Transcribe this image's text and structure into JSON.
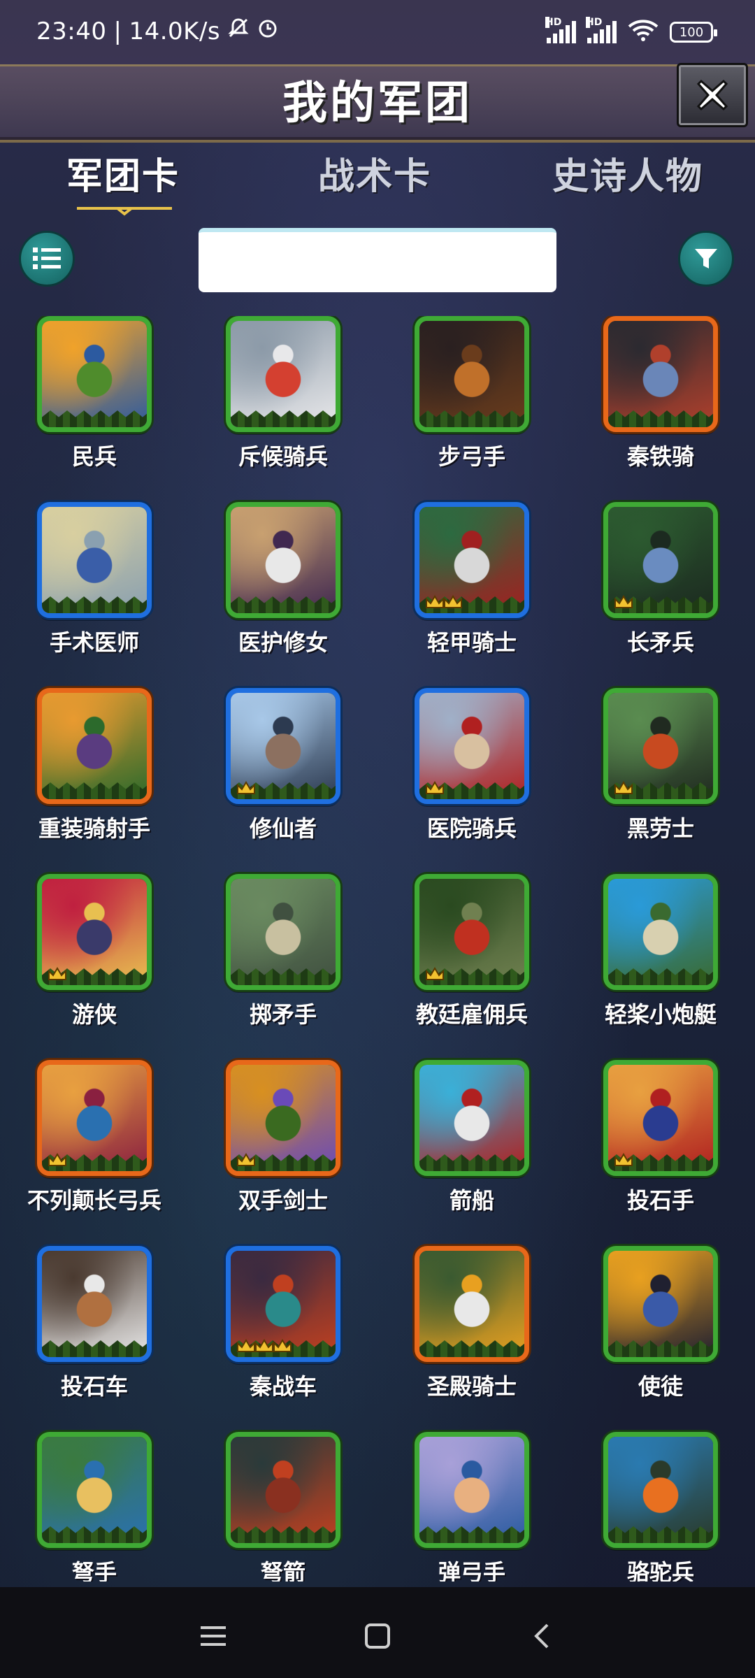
{
  "status_bar": {
    "time": "23:40",
    "network_speed": "14.0K/s",
    "battery": "100",
    "icons": [
      "bell-muted-icon",
      "alarm-icon",
      "signal-hd-icon",
      "signal-hd-icon",
      "wifi-icon",
      "battery-icon"
    ]
  },
  "header": {
    "title": "我的军团",
    "close_icon": "close-x-icon"
  },
  "tabs": [
    {
      "label": "军团卡",
      "active": true
    },
    {
      "label": "战术卡",
      "active": false
    },
    {
      "label": "史诗人物",
      "active": false
    }
  ],
  "toolbar": {
    "menu_icon": "list-icon",
    "filter_icon": "filter-funnel-icon",
    "search_value": "",
    "search_placeholder": ""
  },
  "colors": {
    "green": "#3faa35",
    "blue": "#1f6fe0",
    "orange": "#e8681a",
    "accent_teal": "#1e7f7d",
    "crown": "#f2c230"
  },
  "cards": [
    {
      "name": "民兵",
      "rarity": "green",
      "crowns": 0
    },
    {
      "name": "斥候骑兵",
      "rarity": "green",
      "crowns": 0
    },
    {
      "name": "步弓手",
      "rarity": "green",
      "crowns": 0
    },
    {
      "name": "秦铁骑",
      "rarity": "orange",
      "crowns": 0
    },
    {
      "name": "手术医师",
      "rarity": "blue",
      "crowns": 0
    },
    {
      "name": "医护修女",
      "rarity": "green",
      "crowns": 0
    },
    {
      "name": "轻甲骑士",
      "rarity": "blue",
      "crowns": 2
    },
    {
      "name": "长矛兵",
      "rarity": "green",
      "crowns": 1
    },
    {
      "name": "重装骑射手",
      "rarity": "orange",
      "crowns": 0
    },
    {
      "name": "修仙者",
      "rarity": "blue",
      "crowns": 1
    },
    {
      "name": "医院骑兵",
      "rarity": "blue",
      "crowns": 1
    },
    {
      "name": "黑劳士",
      "rarity": "green",
      "crowns": 1
    },
    {
      "name": "游侠",
      "rarity": "green",
      "crowns": 1
    },
    {
      "name": "掷矛手",
      "rarity": "green",
      "crowns": 0
    },
    {
      "name": "教廷雇佣兵",
      "rarity": "green",
      "crowns": 1
    },
    {
      "name": "轻桨小炮艇",
      "rarity": "green",
      "crowns": 0
    },
    {
      "name": "不列颠长弓兵",
      "rarity": "orange",
      "crowns": 1
    },
    {
      "name": "双手剑士",
      "rarity": "orange",
      "crowns": 1
    },
    {
      "name": "箭船",
      "rarity": "green",
      "crowns": 0
    },
    {
      "name": "投石手",
      "rarity": "green",
      "crowns": 1
    },
    {
      "name": "投石车",
      "rarity": "blue",
      "crowns": 0
    },
    {
      "name": "秦战车",
      "rarity": "blue",
      "crowns": 3
    },
    {
      "name": "圣殿骑士",
      "rarity": "orange",
      "crowns": 0
    },
    {
      "name": "使徒",
      "rarity": "green",
      "crowns": 0
    },
    {
      "name": "弩手",
      "rarity": "green",
      "crowns": 0
    },
    {
      "name": "弩箭",
      "rarity": "green",
      "crowns": 0
    },
    {
      "name": "弹弓手",
      "rarity": "green",
      "crowns": 0
    },
    {
      "name": "骆驼兵",
      "rarity": "green",
      "crowns": 0
    }
  ],
  "nav": {
    "icons": [
      "menu-recent-icon",
      "home-square-icon",
      "back-chevron-icon"
    ]
  }
}
